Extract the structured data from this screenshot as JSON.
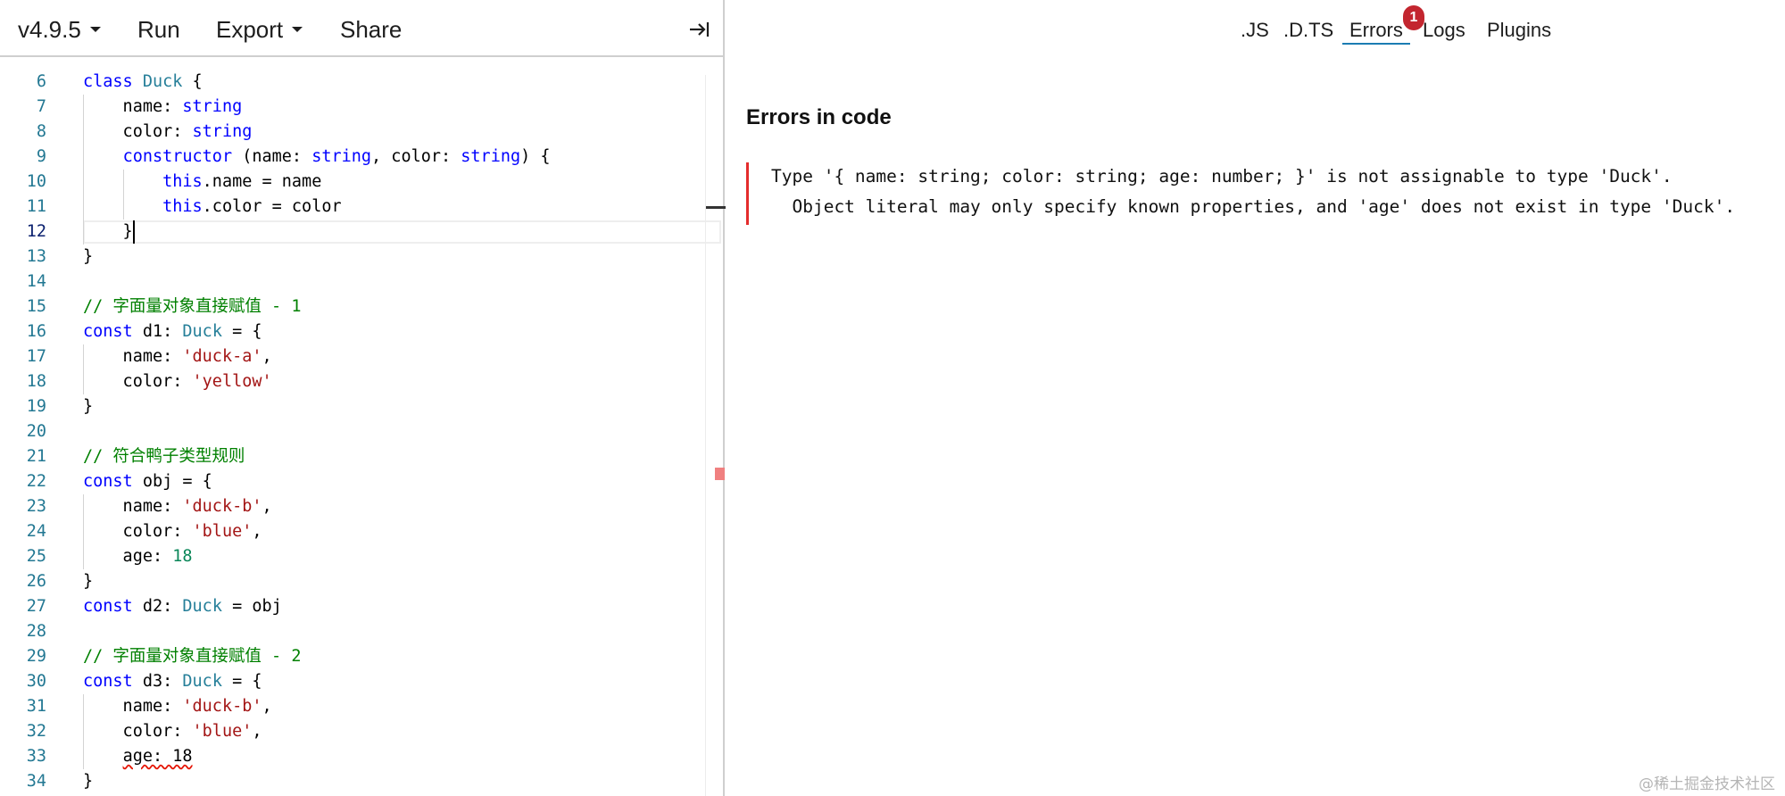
{
  "toolbar": {
    "version_label": "v4.9.5",
    "run_label": "Run",
    "export_label": "Export",
    "share_label": "Share",
    "collapse_icon": "arrow-right-to-bar-icon"
  },
  "editor": {
    "active_line": "12",
    "lines": [
      {
        "n": "6",
        "parts": [
          [
            "kw",
            "class"
          ],
          [
            "",
            " "
          ],
          [
            "ty",
            "Duck"
          ],
          [
            "",
            " {"
          ]
        ]
      },
      {
        "n": "7",
        "parts": [
          [
            "",
            "    name: "
          ],
          [
            "kw",
            "string"
          ]
        ]
      },
      {
        "n": "8",
        "parts": [
          [
            "",
            "    color: "
          ],
          [
            "kw",
            "string"
          ]
        ]
      },
      {
        "n": "9",
        "parts": [
          [
            "",
            "    "
          ],
          [
            "kw",
            "constructor"
          ],
          [
            "",
            " (name: "
          ],
          [
            "kw",
            "string"
          ],
          [
            "",
            ", color: "
          ],
          [
            "kw",
            "string"
          ],
          [
            "",
            ") {"
          ]
        ]
      },
      {
        "n": "10",
        "parts": [
          [
            "",
            "        "
          ],
          [
            "kw",
            "this"
          ],
          [
            "",
            ".name = name"
          ]
        ]
      },
      {
        "n": "11",
        "parts": [
          [
            "",
            "        "
          ],
          [
            "kw",
            "this"
          ],
          [
            "",
            ".color = color"
          ]
        ]
      },
      {
        "n": "12",
        "parts": [
          [
            "",
            "    }"
          ]
        ]
      },
      {
        "n": "13",
        "parts": [
          [
            "",
            "}"
          ]
        ]
      },
      {
        "n": "14",
        "parts": []
      },
      {
        "n": "15",
        "parts": [
          [
            "cm",
            "// 字面量对象直接赋值 - 1"
          ]
        ]
      },
      {
        "n": "16",
        "parts": [
          [
            "kw",
            "const"
          ],
          [
            "",
            " d1: "
          ],
          [
            "ty",
            "Duck"
          ],
          [
            "",
            " = {"
          ]
        ]
      },
      {
        "n": "17",
        "parts": [
          [
            "",
            "    name: "
          ],
          [
            "str",
            "'duck-a'"
          ],
          [
            "",
            ","
          ]
        ]
      },
      {
        "n": "18",
        "parts": [
          [
            "",
            "    color: "
          ],
          [
            "str",
            "'yellow'"
          ]
        ]
      },
      {
        "n": "19",
        "parts": [
          [
            "",
            "}"
          ]
        ]
      },
      {
        "n": "20",
        "parts": []
      },
      {
        "n": "21",
        "parts": [
          [
            "cm",
            "// 符合鸭子类型规则"
          ]
        ]
      },
      {
        "n": "22",
        "parts": [
          [
            "kw",
            "const"
          ],
          [
            "",
            " obj = {"
          ]
        ]
      },
      {
        "n": "23",
        "parts": [
          [
            "",
            "    name: "
          ],
          [
            "str",
            "'duck-b'"
          ],
          [
            "",
            ","
          ]
        ]
      },
      {
        "n": "24",
        "parts": [
          [
            "",
            "    color: "
          ],
          [
            "str",
            "'blue'"
          ],
          [
            "",
            ","
          ]
        ]
      },
      {
        "n": "25",
        "parts": [
          [
            "",
            "    age: "
          ],
          [
            "num",
            "18"
          ]
        ]
      },
      {
        "n": "26",
        "parts": [
          [
            "",
            "}"
          ]
        ]
      },
      {
        "n": "27",
        "parts": [
          [
            "kw",
            "const"
          ],
          [
            "",
            " d2: "
          ],
          [
            "ty",
            "Duck"
          ],
          [
            "",
            " = obj"
          ]
        ]
      },
      {
        "n": "28",
        "parts": []
      },
      {
        "n": "29",
        "parts": [
          [
            "cm",
            "// 字面量对象直接赋值 - 2"
          ]
        ]
      },
      {
        "n": "30",
        "parts": [
          [
            "kw",
            "const"
          ],
          [
            "",
            " d3: "
          ],
          [
            "ty",
            "Duck"
          ],
          [
            "",
            " = {"
          ]
        ]
      },
      {
        "n": "31",
        "parts": [
          [
            "",
            "    name: "
          ],
          [
            "str",
            "'duck-b'"
          ],
          [
            "",
            ","
          ]
        ]
      },
      {
        "n": "32",
        "parts": [
          [
            "",
            "    color: "
          ],
          [
            "str",
            "'blue'"
          ],
          [
            "",
            ","
          ]
        ]
      },
      {
        "n": "33",
        "parts": [
          [
            "",
            "    "
          ],
          [
            "squiggle",
            "age: 18"
          ]
        ]
      },
      {
        "n": "34",
        "parts": [
          [
            "",
            "}"
          ]
        ]
      }
    ]
  },
  "panel": {
    "tabs": [
      ".JS",
      ".D.TS",
      "Errors",
      "Logs",
      "Plugins"
    ],
    "active_tab": "Errors",
    "error_badge": "1",
    "title": "Errors in code",
    "error_line_1": "Type '{ name: string; color: string; age: number; }' is not assignable to type 'Duck'.",
    "error_line_2": "  Object literal may only specify known properties, and 'age' does not exist in type 'Duck'."
  },
  "watermark": "@稀土掘金技术社区",
  "colors": {
    "keyword": "#0000ff",
    "type": "#267f99",
    "string": "#a31515",
    "number": "#098658",
    "comment": "#008000",
    "line_number": "#237893",
    "error": "#e42c2c",
    "tab_underline": "#1b7cb3",
    "badge": "#c3262f"
  }
}
